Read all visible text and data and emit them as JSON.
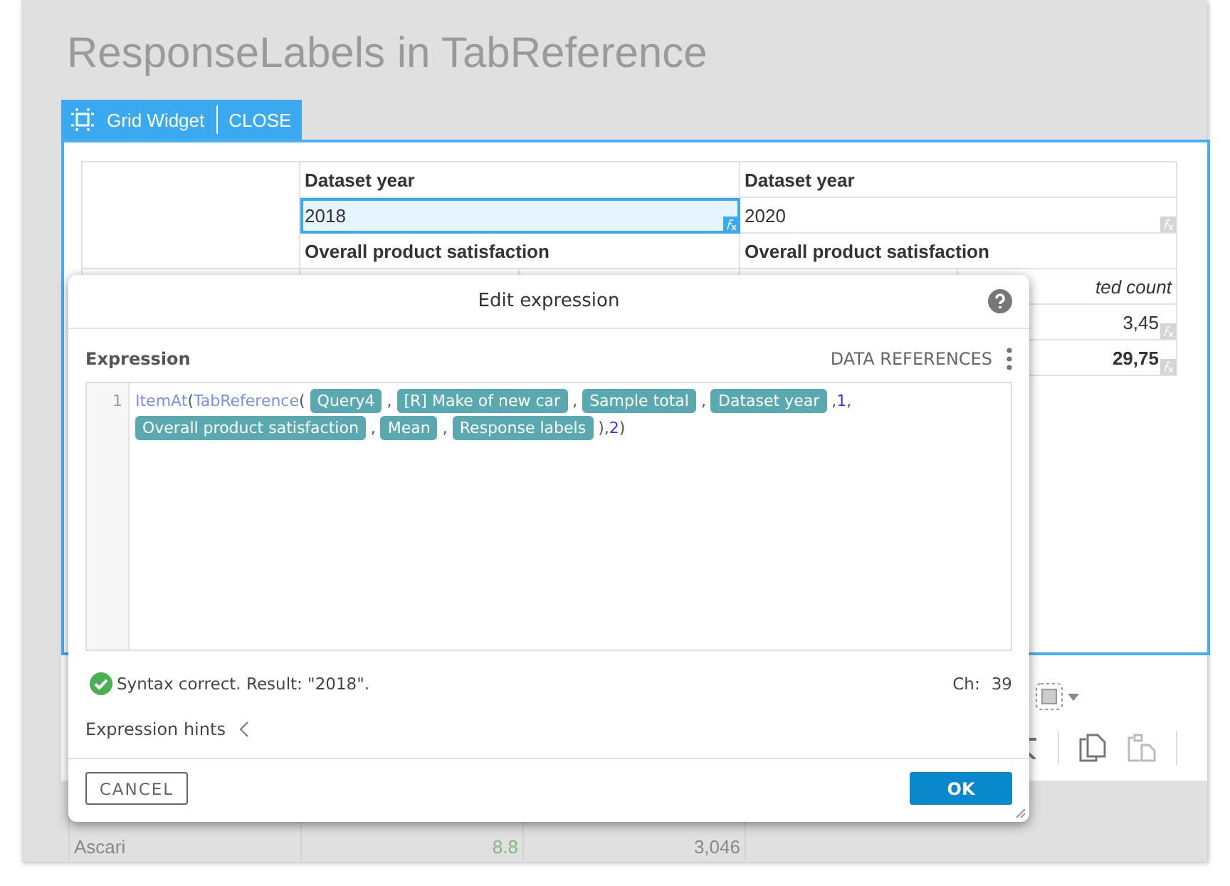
{
  "page_title": "ResponseLabels in TabReference",
  "widget": {
    "tab_label": "Grid Widget",
    "close_label": "CLOSE"
  },
  "grid": {
    "dataset_labels": [
      "Dataset year",
      "Dataset year"
    ],
    "years": [
      {
        "text": "2018",
        "selected": true
      },
      {
        "text": "2020",
        "selected": false
      }
    ],
    "questions": [
      "Overall product satisfaction",
      "Overall product satisfaction"
    ],
    "sub_header": "ted count",
    "values": [
      {
        "text": "3,45",
        "bold": false
      },
      {
        "text": "29,75",
        "bold": true
      }
    ]
  },
  "lower_rows": [
    {
      "cells": [
        "Ascari",
        "8.8",
        "3,046"
      ]
    }
  ],
  "dialog": {
    "title": "Edit expression",
    "section_label": "Expression",
    "data_references": "DATA REFERENCES",
    "line_number": "1",
    "code_rows": [
      [
        {
          "kind": "function",
          "text": "ItemAt"
        },
        {
          "kind": "punct",
          "text": "("
        },
        {
          "kind": "function",
          "text": "TabReference"
        },
        {
          "kind": "punct",
          "text": "( "
        },
        {
          "kind": "chip",
          "text": "Query4"
        },
        {
          "kind": "punct",
          "text": " , "
        },
        {
          "kind": "chip",
          "text": "[R] Make of new car"
        },
        {
          "kind": "punct",
          "text": " , "
        },
        {
          "kind": "chip",
          "text": "Sample total"
        },
        {
          "kind": "punct",
          "text": " , "
        },
        {
          "kind": "chip",
          "text": "Dataset year"
        },
        {
          "kind": "punct",
          "text": " ,"
        },
        {
          "kind": "number",
          "text": "1"
        },
        {
          "kind": "punct",
          "text": ","
        }
      ],
      [
        {
          "kind": "chip",
          "text": "Overall product satisfaction"
        },
        {
          "kind": "punct",
          "text": " , "
        },
        {
          "kind": "chip",
          "text": "Mean"
        },
        {
          "kind": "punct",
          "text": " , "
        },
        {
          "kind": "chip",
          "text": "Response labels"
        },
        {
          "kind": "punct",
          "text": " ),"
        },
        {
          "kind": "number",
          "text": "2"
        },
        {
          "kind": "punct",
          "text": ")"
        }
      ]
    ],
    "status": "Syntax correct. Result: \"2018\".",
    "char_label": "Ch:",
    "char_count": "39",
    "hints_label": "Expression hints",
    "cancel": "CANCEL",
    "ok": "OK"
  }
}
